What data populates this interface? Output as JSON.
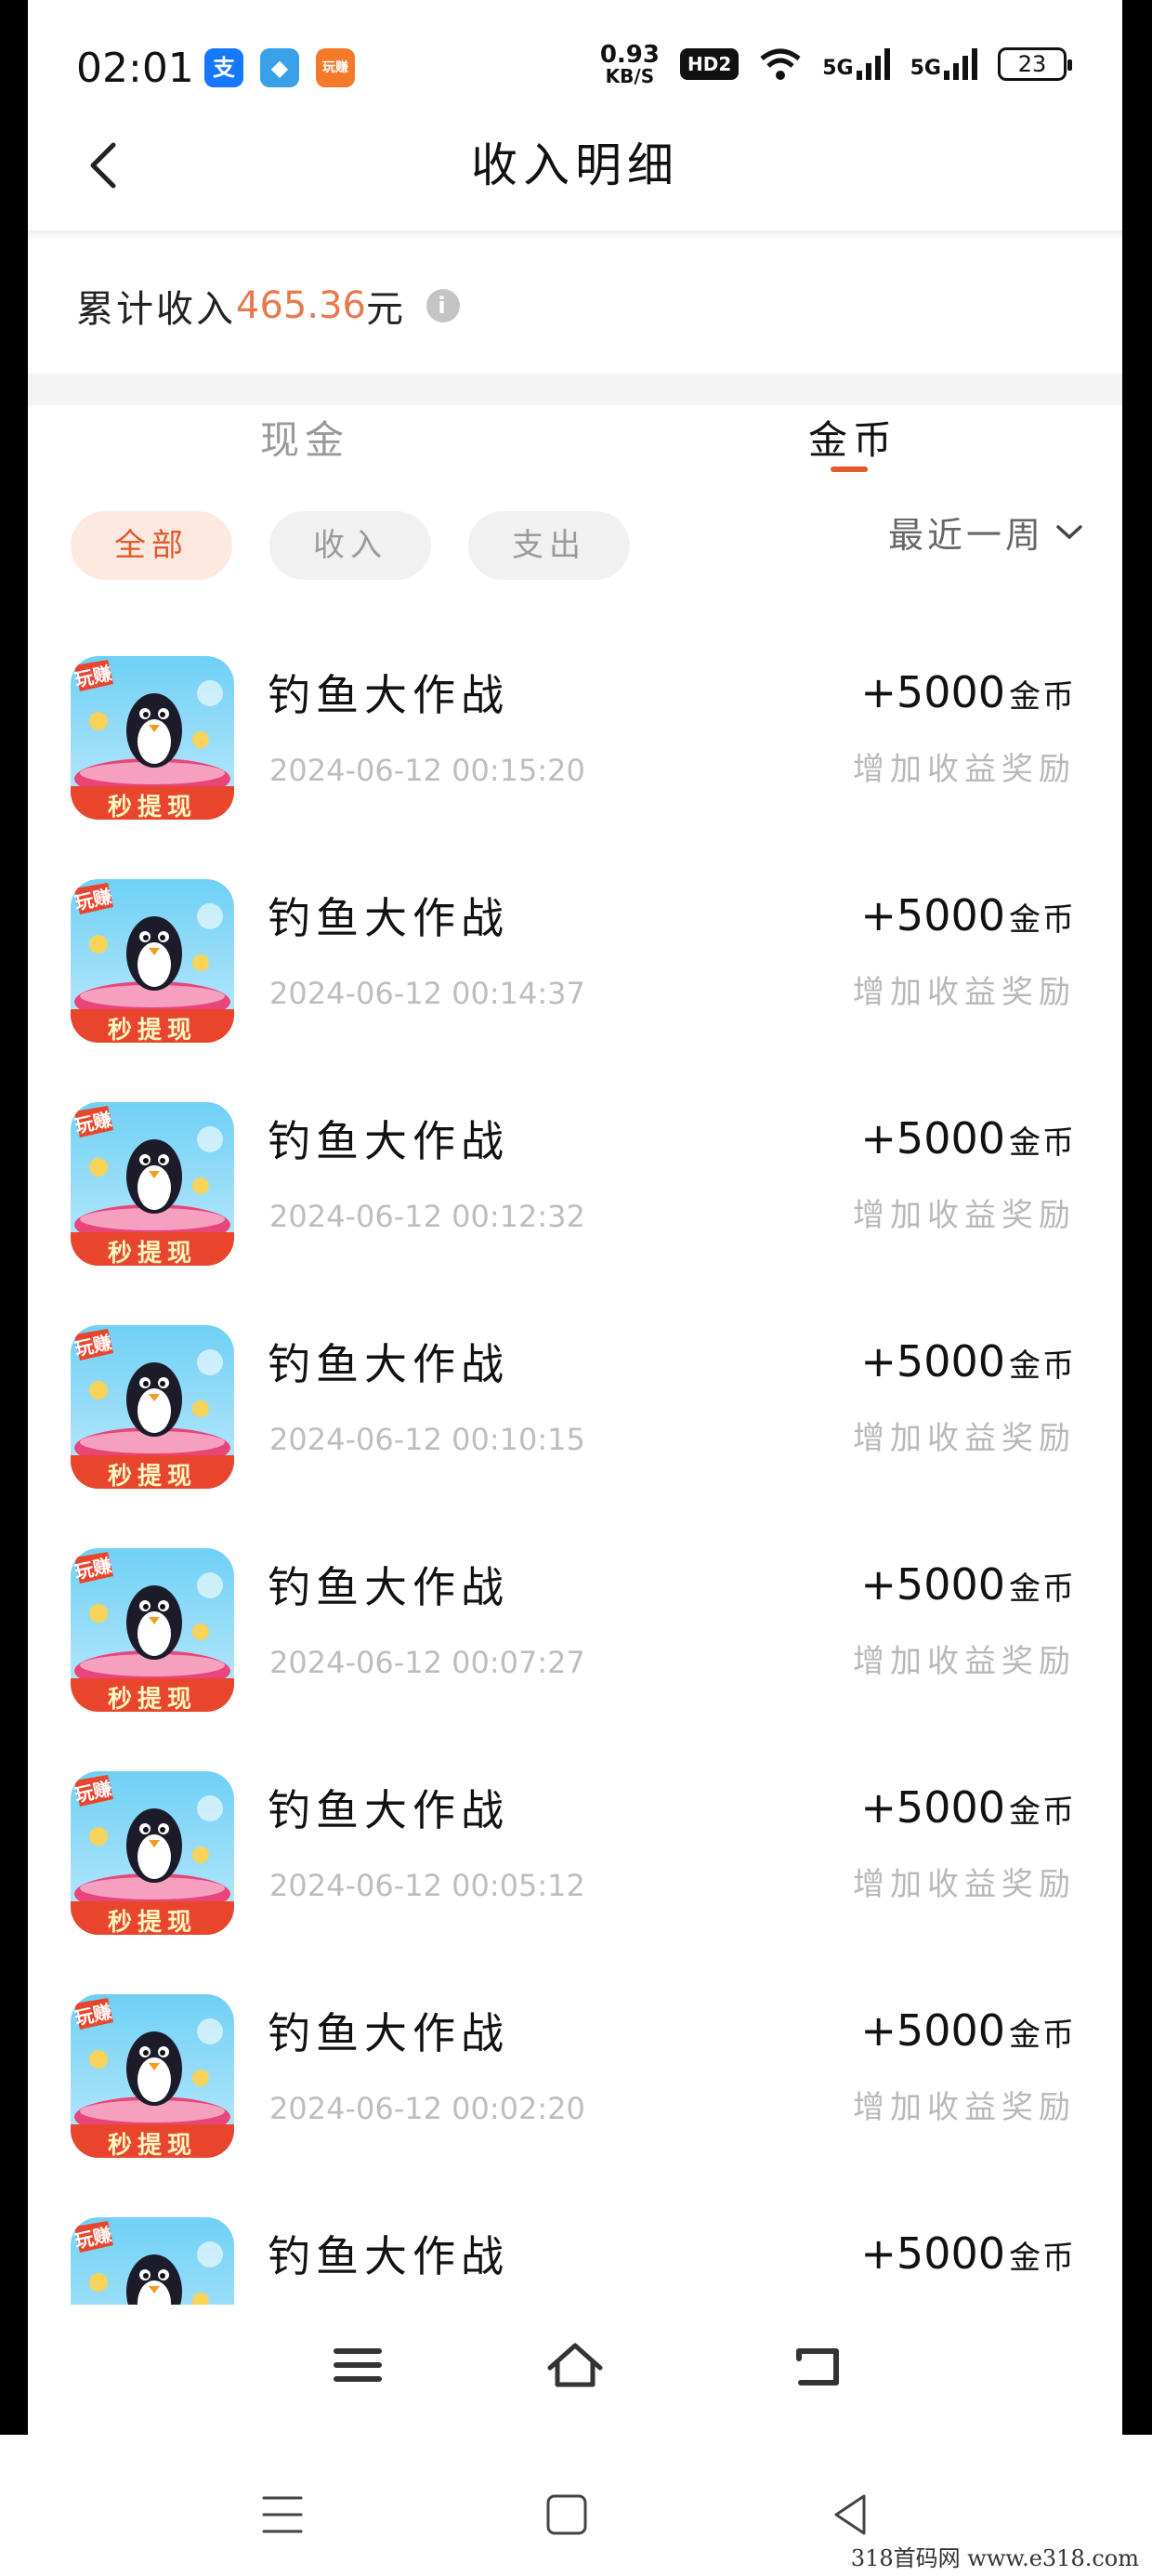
{
  "status_bar": {
    "time": "02:01",
    "net_speed_value": "0.93",
    "net_speed_unit": "KB/S",
    "hd_label": "HD2",
    "signal1": "5G",
    "signal2": "5G",
    "battery": "23",
    "apps": [
      {
        "icon": "alipay-icon",
        "glyph": "支",
        "color": "#1677ff"
      },
      {
        "icon": "app-icon-blue",
        "glyph": "◆",
        "color": "#3aa0e8"
      },
      {
        "icon": "app-icon-orange",
        "glyph": "玩赚",
        "color": "#f47a2a"
      }
    ]
  },
  "header": {
    "title": "收入明细"
  },
  "summary": {
    "label": "累计收入",
    "amount": "465.36",
    "unit": "元"
  },
  "tabs": [
    {
      "label": "现金",
      "active": false
    },
    {
      "label": "金币",
      "active": true
    }
  ],
  "filters": {
    "chips": [
      "全部",
      "收入",
      "支出"
    ],
    "active": "全部",
    "period": "最近一周"
  },
  "records": [
    {
      "name": "钓鱼大作战",
      "time": "2024-06-12 00:15:20",
      "amount": "+5000",
      "unit": "金币",
      "desc": "增加收益奖励"
    },
    {
      "name": "钓鱼大作战",
      "time": "2024-06-12 00:14:37",
      "amount": "+5000",
      "unit": "金币",
      "desc": "增加收益奖励"
    },
    {
      "name": "钓鱼大作战",
      "time": "2024-06-12 00:12:32",
      "amount": "+5000",
      "unit": "金币",
      "desc": "增加收益奖励"
    },
    {
      "name": "钓鱼大作战",
      "time": "2024-06-12 00:10:15",
      "amount": "+5000",
      "unit": "金币",
      "desc": "增加收益奖励"
    },
    {
      "name": "钓鱼大作战",
      "time": "2024-06-12 00:07:27",
      "amount": "+5000",
      "unit": "金币",
      "desc": "增加收益奖励"
    },
    {
      "name": "钓鱼大作战",
      "time": "2024-06-12 00:05:12",
      "amount": "+5000",
      "unit": "金币",
      "desc": "增加收益奖励"
    },
    {
      "name": "钓鱼大作战",
      "time": "2024-06-12 00:02:20",
      "amount": "+5000",
      "unit": "金币",
      "desc": "增加收益奖励"
    },
    {
      "name": "钓鱼大作战",
      "time": "",
      "amount": "+5000",
      "unit": "金币",
      "desc": ""
    }
  ],
  "app_icon_badges": {
    "top": "玩赚",
    "bottom": "秒提现"
  },
  "bottom_nav": [
    "menu-icon",
    "home-icon",
    "return-icon"
  ],
  "system_nav": [
    "recents-icon",
    "home-square-icon",
    "back-triangle-icon"
  ],
  "watermark": "318首码网 www.e318.com",
  "colors": {
    "accent": "#e05a2b",
    "amount": "#e8794d",
    "chip_active_bg": "#fde9df"
  }
}
